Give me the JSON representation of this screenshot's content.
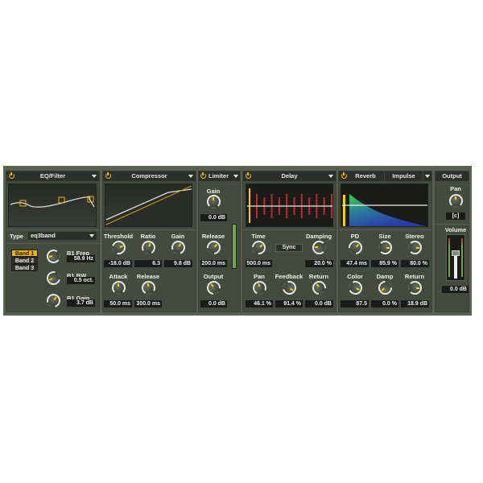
{
  "eq": {
    "title": "EQ/Filter",
    "type_label": "Type",
    "type_value": "eq3band",
    "bands": [
      "Band 1",
      "Band 2",
      "Band 3"
    ],
    "selected_band": "Band 1",
    "params": [
      {
        "label": "B1 Freq",
        "value": "58.9 Hz"
      },
      {
        "label": "B1 BW",
        "value": "0.5 oct."
      },
      {
        "label": "B1 Gain",
        "value": "3.7 dB"
      }
    ]
  },
  "compressor": {
    "title": "Compressor",
    "params": [
      {
        "label": "Threshold",
        "value": "-18.0 dB"
      },
      {
        "label": "Ratio",
        "value": "6.3"
      },
      {
        "label": "Gain",
        "value": "9.8 dB"
      },
      {
        "label": "Attack",
        "value": "50.0 ms"
      },
      {
        "label": "Release",
        "value": "300.0 ms"
      }
    ]
  },
  "limiter": {
    "title": "Limiter",
    "params": [
      {
        "label": "Gain",
        "value": "0.0 dB"
      },
      {
        "label": "Release",
        "value": "200.0 ms"
      },
      {
        "label": "Output",
        "value": "0.0 dB"
      }
    ]
  },
  "delay": {
    "title": "Delay",
    "sync_label": "Sync",
    "params": [
      {
        "label": "Time",
        "value": "500.0 ms"
      },
      {
        "label": "Damping",
        "value": "20.0 %"
      },
      {
        "label": "Pan",
        "value": "46.1 %"
      },
      {
        "label": "Feedback",
        "value": "91.4 %"
      },
      {
        "label": "Return",
        "value": "0.0 dB"
      }
    ]
  },
  "reverb": {
    "title": "Reverb",
    "preset": "Impulse",
    "params": [
      {
        "label": "PD",
        "value": "47.4 ms"
      },
      {
        "label": "Size",
        "value": "85.9 %"
      },
      {
        "label": "Stereo",
        "value": "80.0 %"
      },
      {
        "label": "Color",
        "value": "87.5"
      },
      {
        "label": "Damp",
        "value": "0.0 %"
      },
      {
        "label": "Return",
        "value": "18.9 dB"
      }
    ]
  },
  "output": {
    "title": "Output",
    "pan_label": "Pan",
    "pan_value": "[c]",
    "volume_label": "Volume",
    "volume_value": "0.0 dB"
  },
  "colors": {
    "accent": "#f2b400",
    "delay_taps": "#c0282a",
    "knob_indicator": "#f2d000"
  }
}
